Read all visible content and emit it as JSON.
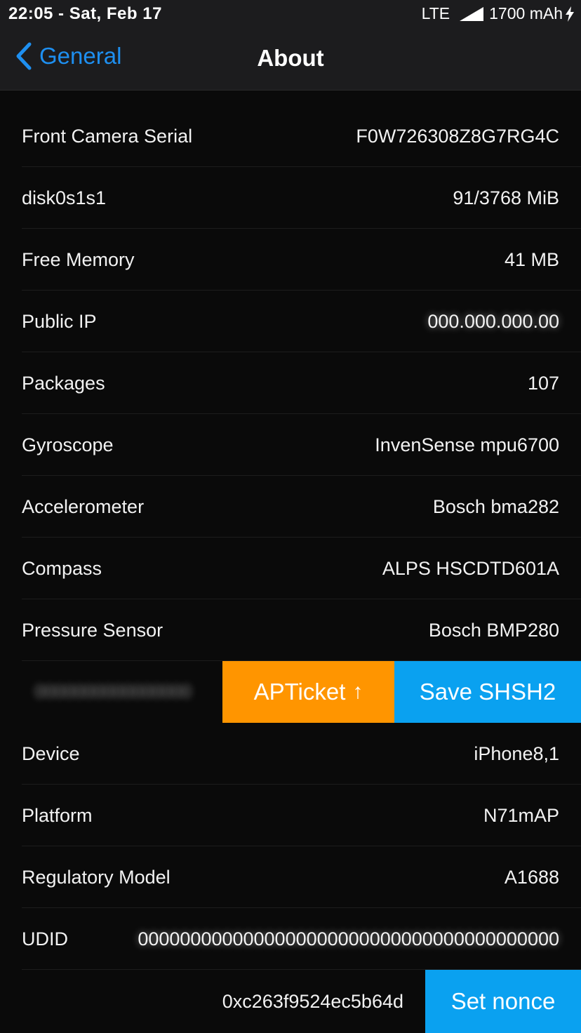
{
  "status_bar": {
    "time": "22:05 - Sat, Feb 17",
    "network": "LTE",
    "battery": "1700 mAh"
  },
  "nav": {
    "back_label": "General",
    "title": "About"
  },
  "rows_top": [
    {
      "label": "Front Camera Serial",
      "value": "F0W726308Z8G7RG4C"
    },
    {
      "label": "disk0s1s1",
      "value": "91/3768 MiB"
    },
    {
      "label": "Free Memory",
      "value": "41 MB"
    },
    {
      "label": "Public IP",
      "value": "",
      "blurred": true
    },
    {
      "label": "Packages",
      "value": "107"
    },
    {
      "label": "Gyroscope",
      "value": "InvenSense mpu6700"
    },
    {
      "label": "Accelerometer",
      "value": "Bosch bma282"
    },
    {
      "label": "Compass",
      "value": "ALPS HSCDTD601A"
    },
    {
      "label": "Pressure Sensor",
      "value": "Bosch BMP280"
    }
  ],
  "swipe_actions": {
    "apticket_label": "APTicket",
    "save_shsh2_label": "Save SHSH2"
  },
  "rows_bottom": [
    {
      "label": "Device",
      "value": "iPhone8,1"
    },
    {
      "label": "Platform",
      "value": "N71mAP"
    },
    {
      "label": "Regulatory Model",
      "value": "A1688"
    },
    {
      "label": "UDID",
      "value": "",
      "blurred": true
    }
  ],
  "nonce": {
    "value": "0xc263f9524ec5b64d",
    "set_nonce_label": "Set nonce"
  },
  "colors": {
    "accent_blue": "#0aa1f0",
    "back_blue": "#1e8ff0",
    "apticket_orange": "#ff9500",
    "background": "#0a0a0a"
  }
}
